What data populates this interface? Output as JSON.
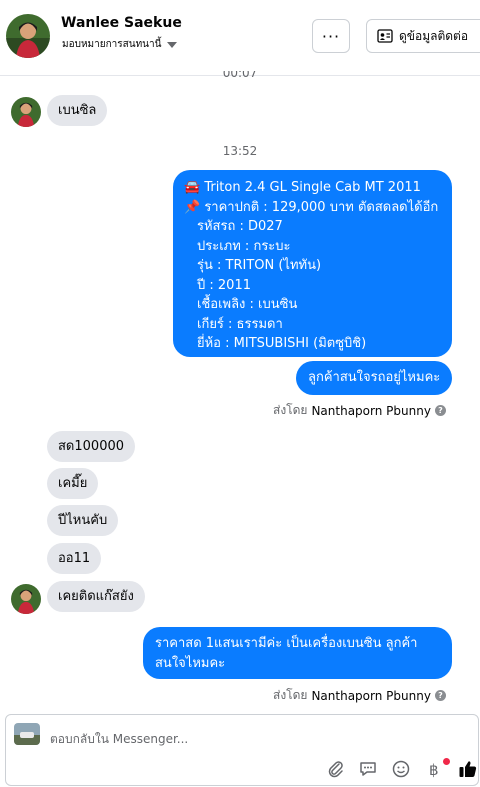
{
  "header": {
    "name": "Wanlee Saekue",
    "subtitle": "มอบหมายการสนทนานี้",
    "more_label": "···",
    "contact_label": "ดูข้อมูลติดต่อ"
  },
  "thread": {
    "partial_time": "00:07",
    "time_1": "13:52",
    "msg_in_1": "เบนซิล",
    "msg_out_1_lines": [
      "🚘 Triton 2.4 GL Single Cab MT 2011",
      "📌 ราคาปกติ : 129,000 บาท ตัดสดลดได้อีก",
      "รหัสรถ : D027",
      "ประเภท : กระบะ",
      "รุ่น : TRITON (ไททัน)",
      "ปี : 2011",
      "เชื้อเพลิง : เบนซิน",
      "เกียร์ : ธรรมดา",
      "ยี่ห้อ : MITSUBISHI (มิตซูบิชิ)"
    ],
    "msg_out_2": "ลูกค้าสนใจรถอยู่ไหมคะ",
    "sent_by_label": "ส่งโดย",
    "sent_by_name": "Nanthaporn Pbunny",
    "msg_in_2": "สด100000",
    "msg_in_3": "เคมี๊ย",
    "msg_in_4": "ปีไหนคับ",
    "msg_in_5": "ออ11",
    "msg_in_6": "เคยติดแก๊สยัง",
    "msg_out_3_lines": [
      "ราคาสด 1แสนเรามีค่ะ เป็นเครื่องเบนซิน ลูกค้า",
      "สนใจไหมคะ"
    ],
    "sent_by_label_2": "ส่งโดย",
    "sent_by_name_2": "Nanthaporn Pbunny"
  },
  "composer": {
    "placeholder": "ตอบกลับใน Messenger..."
  },
  "icons": [
    "paperclip-icon",
    "message-icon",
    "emoji-icon",
    "baht-icon",
    "thumbs-up-icon",
    "contact-card-icon",
    "help-icon"
  ],
  "colors": {
    "outgoing_bubble": "#0a7cff",
    "incoming_bubble": "#e4e6eb",
    "like_icon": "#050505",
    "notification_dot": "#f02849"
  }
}
